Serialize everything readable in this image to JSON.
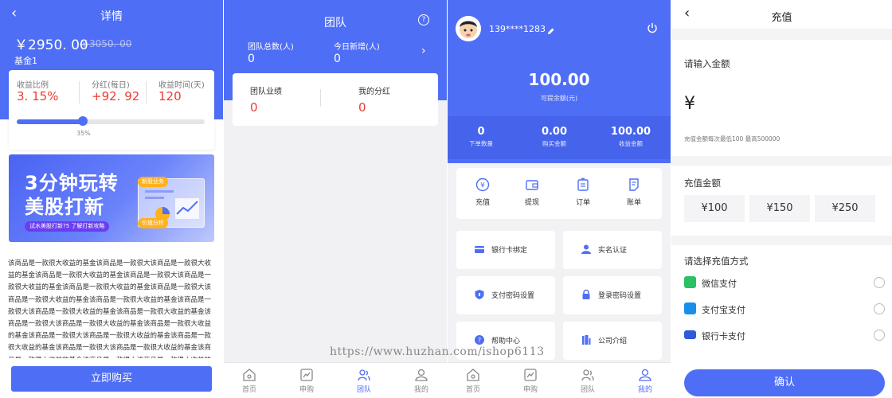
{
  "detail": {
    "back_icon": "chevron-left-icon",
    "title": "详情",
    "price": "￥2950. 00",
    "original_price": "￥3050. 00",
    "fund_name": "基金1",
    "stats": [
      {
        "label": "收益比例",
        "value": "3. 15%"
      },
      {
        "label": "分红(每日)",
        "value": "+92. 92"
      },
      {
        "label": "收益时间(天)",
        "value": "120"
      }
    ],
    "progress_percent": 35,
    "progress_label": "35%",
    "banner": {
      "line1": "3分钟玩转",
      "line2": "美股打新",
      "tag": "试水美股打新?5 了解打新攻略",
      "pill1": "新股业务",
      "pill2": "价值分析"
    },
    "description": "该商品是一款很大收益的基金该商品是一款很大该商品是一款很大收益的基金该商品是一款很大收益的基金该商品是一款很大该商品是一款很大收益的基金该商品是一款很大收益的基金该商品是一款很大该商品是一款很大收益的基金该商品是一款很大收益的基金该商品是一款很大该商品是一款很大收益的基金该商品是一款很大收益的基金该商品是一款很大该商品是一款很大收益的基金该商品是一款很大收益的基金该商品是一款很大该商品是一款很大收益的基金该商品是一款很大收益的基金该商品是一款很大该商品是一款很大收益的基金该商品是一款很大收益的基金该商品是一款很大该商品是一款很大收益的基金该商品是一款很大收益的基金该商品是一款很大该商品是一款很大收益的基金该商品是一",
    "buy_button": "立即购买",
    "accent": "#4f6ef6"
  },
  "team": {
    "title": "团队",
    "help_icon": "question-circle-icon",
    "total_label": "团队总数(人)",
    "total_value": "0",
    "today_label": "今日新增(人)",
    "today_value": "0",
    "performance_label": "团队业绩",
    "performance_value": "0",
    "dividend_label": "我的分红",
    "dividend_value": "0"
  },
  "tabbar": {
    "items": [
      {
        "label": "首页",
        "icon": "home-icon"
      },
      {
        "label": "申购",
        "icon": "chart-icon"
      },
      {
        "label": "团队",
        "icon": "team-icon"
      },
      {
        "label": "我的",
        "icon": "user-icon"
      }
    ]
  },
  "mine": {
    "phone": "139****1283",
    "edit_icon": "pencil-icon",
    "power_icon": "power-icon",
    "balance": "100.00",
    "balance_label": "可提余额(元)",
    "stats": [
      {
        "value": "0",
        "label": "下单数量"
      },
      {
        "value": "0.00",
        "label": "购买金额"
      },
      {
        "value": "100.00",
        "label": "收益金额"
      }
    ],
    "quick": [
      {
        "label": "充值",
        "icon": "yen-circle-icon"
      },
      {
        "label": "提现",
        "icon": "wallet-icon"
      },
      {
        "label": "订单",
        "icon": "clipboard-icon"
      },
      {
        "label": "账单",
        "icon": "bill-icon"
      }
    ],
    "menu": [
      {
        "label": "银行卡绑定",
        "icon": "bank-card-icon"
      },
      {
        "label": "实名认证",
        "icon": "id-user-icon"
      },
      {
        "label": "支付密码设置",
        "icon": "shield-icon"
      },
      {
        "label": "登录密码设置",
        "icon": "lock-icon"
      },
      {
        "label": "帮助中心",
        "icon": "help-icon"
      },
      {
        "label": "公司介绍",
        "icon": "building-icon"
      }
    ],
    "watermark": "https://www.huzhan.com/ishop6113"
  },
  "recharge": {
    "back_icon": "chevron-left-icon",
    "title": "充值",
    "input_label": "请输入金额",
    "currency": "¥",
    "hint": "充值金额每次最低100 最高500000",
    "amount_label": "充值金额",
    "amounts": [
      "¥100",
      "¥150",
      "¥250"
    ],
    "method_label": "请选择充值方式",
    "methods": [
      {
        "label": "微信支付",
        "icon": "wechat-icon",
        "color": "#2ac064"
      },
      {
        "label": "支付宝支付",
        "icon": "alipay-icon",
        "color": "#1a8fea"
      },
      {
        "label": "银行卡支付",
        "icon": "bank-card-icon",
        "color": "#2f5bd9"
      }
    ],
    "confirm": "确认"
  }
}
